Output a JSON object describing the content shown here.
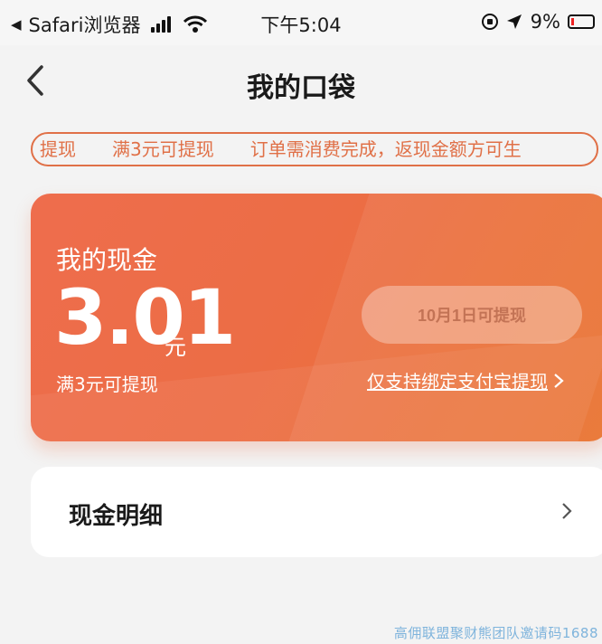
{
  "status_bar": {
    "back_app": "Safari浏览器",
    "time": "下午5:04",
    "battery": "9%"
  },
  "nav": {
    "title": "我的口袋"
  },
  "notice": {
    "items": [
      "提现",
      "满3元可提现",
      "订单需消费完成，返现金额方可生"
    ]
  },
  "card": {
    "label": "我的现金",
    "amount": "3.01",
    "unit": "元",
    "min_withdraw": "满3元可提现",
    "withdraw_button": "10月1日可提现",
    "alipay_link": "仅支持绑定支付宝提现"
  },
  "detail": {
    "label": "现金明细"
  },
  "watermark": "高佣联盟聚财熊团队邀请码1688",
  "colors": {
    "accent": "#ec6d45",
    "notice": "#e07047",
    "background": "#f3f3f3"
  }
}
